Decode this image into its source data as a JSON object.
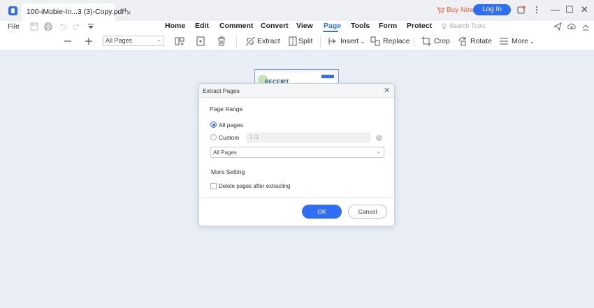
{
  "titlebar": {
    "tab_title": "100-iMobie-In...3 (3)-Copy.pdf",
    "tab_close": "×",
    "tab_add": "+",
    "buy_now": "Buy Now",
    "login": "Log In",
    "minimize": "—",
    "maximize": "☐",
    "close": "✕"
  },
  "menubar": {
    "file": "File",
    "items": [
      "Home",
      "Edit",
      "Comment",
      "Convert",
      "View",
      "Page",
      "Tools",
      "Form",
      "Protect"
    ],
    "active": "Page",
    "search_placeholder": "Search Tools"
  },
  "toolbar": {
    "page_select": "All Pages",
    "extract": "Extract",
    "split": "Split",
    "insert": "Insert",
    "replace": "Replace",
    "crop": "Crop",
    "rotate": "Rotate",
    "more": "More"
  },
  "document": {
    "heading": "RECEIPT"
  },
  "dialog": {
    "title": "Extract Pages",
    "page_range_title": "Page Range",
    "all_pages_label": "All pages",
    "custom_label": "Custom",
    "custom_placeholder": "1 /1",
    "range_select_value": "All Pages",
    "more_setting_title": "More Setting",
    "delete_after_label": "Delete pages after extracting",
    "ok_label": "OK",
    "cancel_label": "Cancel"
  },
  "colors": {
    "accent": "#2f6ff6",
    "buy_now": "#f0622a",
    "canvas_bg": "#e9edf5"
  }
}
